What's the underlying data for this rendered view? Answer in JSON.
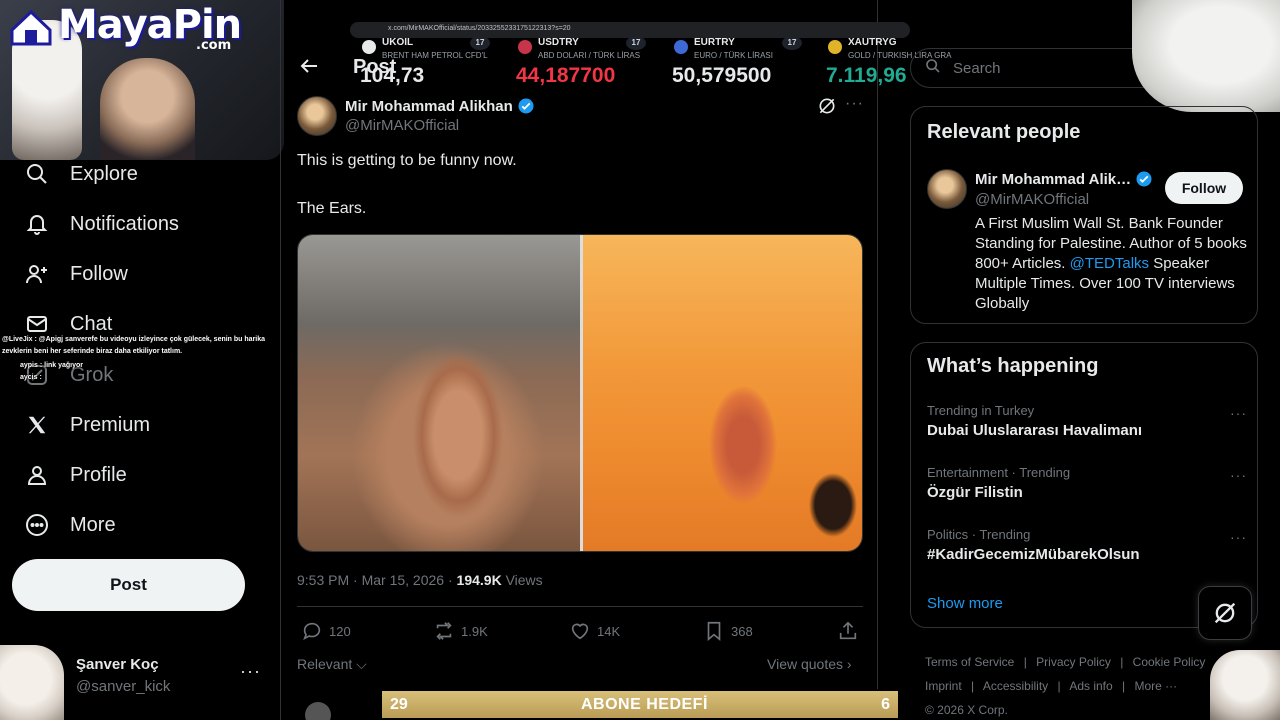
{
  "browser": {
    "url": "x.com/MirMAKOfficial/status/2033255233175122313?s=20"
  },
  "ticker": [
    {
      "symbol": "UKOIL",
      "desc": "BRENT HAM PETROL CFD'L",
      "value": "104,73",
      "color": "#e7e9ea",
      "dot": "#e7e9ea"
    },
    {
      "symbol": "USDTRY",
      "desc": "ABD DOLARI / TÜRK LİRAS",
      "value": "44,187700",
      "color": "#f23645",
      "dot": "#c7354a"
    },
    {
      "symbol": "EURTRY",
      "desc": "EURO / TÜRK LİRASI",
      "value": "50,579500",
      "color": "#e7e9ea",
      "dot": "#3d6ad6"
    },
    {
      "symbol": "XAUTRYG",
      "desc": "GOLD / TURKISH LIRA GRA",
      "value": "7.119,96",
      "color": "#22ab94",
      "dot": "#e0b429"
    }
  ],
  "ticker_badge": "17",
  "stream": {
    "logo": "MayaPin",
    "logo_sub": ".com",
    "chat": [
      "@LiveJix : @Apigj sanverefe bu videoyu izleyince çok gülecek, senin bu harika",
      "zevklerin beni her seferinde biraz daha etkiliyor tatlım.",
      "aypis : link yağıyor",
      "aycis :"
    ],
    "goal": {
      "left": "29",
      "label": "ABONE HEDEFİ",
      "right": "6"
    }
  },
  "nav": {
    "items": [
      {
        "label": "Explore",
        "icon": "search-icon"
      },
      {
        "label": "Notifications",
        "icon": "bell-icon"
      },
      {
        "label": "Follow",
        "icon": "add-user-icon"
      },
      {
        "label": "Chat",
        "icon": "mail-icon"
      },
      {
        "label": "Grok",
        "icon": "grok-icon"
      },
      {
        "label": "Premium",
        "icon": "x-logo-icon"
      },
      {
        "label": "Profile",
        "icon": "person-icon"
      },
      {
        "label": "More",
        "icon": "more-circle-icon"
      }
    ],
    "post_label": "Post",
    "account": {
      "name": "Şanver Koç",
      "handle": "@sanver_kick",
      "more": "···"
    }
  },
  "main": {
    "title": "Post",
    "tweet": {
      "author": "Mir Mohammad Alikhan",
      "handle": "@MirMAKOfficial",
      "text1": "This is getting to be funny now.",
      "text2": "The Ears.",
      "time": "9:53 PM · Mar 15, 2026 · ",
      "views_count": "194.9K",
      "views_label": " Views",
      "replies": "120",
      "reposts": "1.9K",
      "likes": "14K",
      "bookmarks": "368"
    },
    "relevant_label": "Relevant",
    "view_quotes": "View quotes ›"
  },
  "sidebar": {
    "search_placeholder": "Search",
    "relevant_people": {
      "title": "Relevant people",
      "name": "Mir Mohammad Alik…",
      "handle": "@MirMAKOfficial",
      "follow_label": "Follow",
      "bio_before": "A First Muslim Wall St. Bank Founder Standing for Palestine. Author of 5 books 800+ Articles. ",
      "bio_link": "@TEDTalks",
      "bio_after": " Speaker Multiple Times. Over 100 TV interviews Globally"
    },
    "happening": {
      "title": "What’s happening",
      "trends": [
        {
          "category": "Trending in Turkey",
          "title": "Dubai Uluslararası Havalimanı"
        },
        {
          "category": "Entertainment · Trending",
          "title": "Özgür Filistin"
        },
        {
          "category": "Politics · Trending",
          "title": "#KadirGecemizMübarekOlsun"
        }
      ],
      "show_more": "Show more"
    },
    "footer": {
      "links": [
        "Terms of Service",
        "|",
        "Privacy Policy",
        "|",
        "Cookie Policy",
        "Imprint",
        "|",
        "Accessibility",
        "|",
        "Ads info",
        "|",
        "More ···"
      ],
      "copyright": "© 2026 X Corp."
    }
  },
  "colors": {
    "accent": "#1d9bf0",
    "bg": "#000000",
    "border": "#2f3336",
    "muted": "#71767b"
  }
}
